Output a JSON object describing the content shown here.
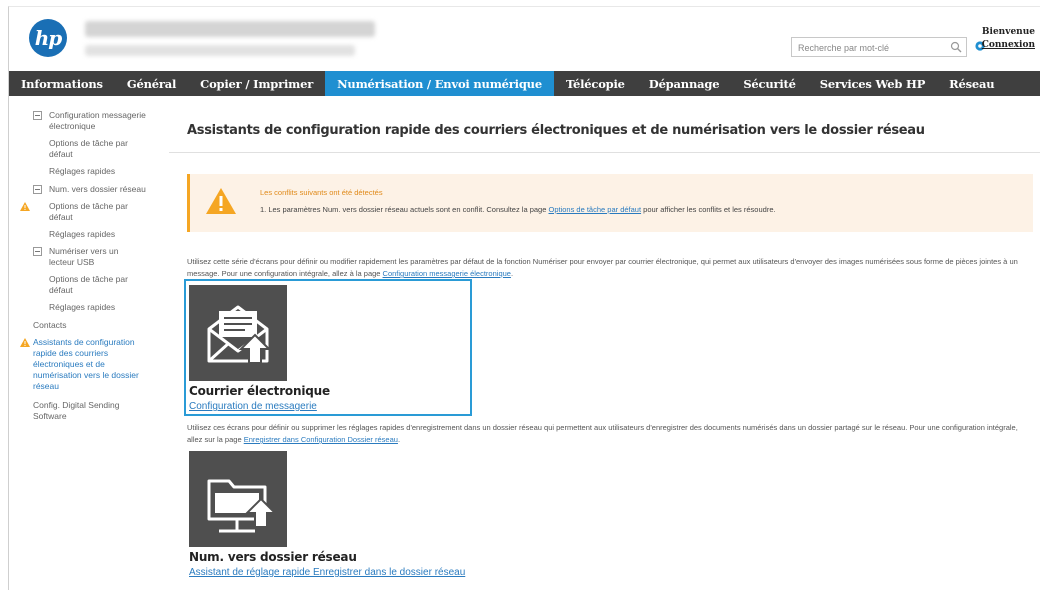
{
  "header": {
    "logo_text": "hp",
    "search_placeholder": "Recherche par mot-clé",
    "welcome": "Bienvenue",
    "login": "Connexion"
  },
  "nav": {
    "tabs": [
      {
        "label": "Informations"
      },
      {
        "label": "Général"
      },
      {
        "label": "Copier / Imprimer"
      },
      {
        "label": "Numérisation / Envoi numérique"
      },
      {
        "label": "Télécopie"
      },
      {
        "label": "Dépannage"
      },
      {
        "label": "Sécurité"
      },
      {
        "label": "Services Web HP"
      },
      {
        "label": "Réseau"
      }
    ],
    "active_index": 3
  },
  "sidebar": {
    "items": [
      {
        "label": "Configuration messagerie électronique"
      },
      {
        "label": "Options de tâche par défaut"
      },
      {
        "label": "Réglages rapides"
      },
      {
        "label": "Num. vers dossier réseau"
      },
      {
        "label": "Options de tâche par défaut"
      },
      {
        "label": "Réglages rapides"
      },
      {
        "label": "Numériser vers un lecteur USB"
      },
      {
        "label": "Options de tâche par défaut"
      },
      {
        "label": "Réglages rapides"
      },
      {
        "label": "Contacts"
      },
      {
        "label": "Assistants de configuration rapide des courriers électroniques et de numérisation vers le dossier réseau"
      },
      {
        "label": "Config. Digital Sending Software"
      }
    ]
  },
  "main": {
    "title": "Assistants de configuration rapide des courriers électroniques et de numérisation vers le dossier réseau",
    "alert": {
      "title": "Les conflits suivants ont été détectés",
      "message_prefix": "1.  Les paramètres Num. vers dossier réseau actuels sont en conflit. Consultez la page ",
      "message_link": "Options de tâche par défaut",
      "message_suffix": " pour afficher les conflits et les résoudre."
    },
    "email_desc_text": "Utilisez cette série d'écrans pour définir ou modifier rapidement les paramètres par défaut de la fonction Numériser pour envoyer par courrier électronique, qui permet aux utilisateurs d'envoyer des images numérisées sous forme de pièces jointes à un message. Pour une configuration intégrale, allez à la page ",
    "email_desc_link": "Configuration messagerie électronique",
    "email_desc_end": ".",
    "email_card": {
      "title": "Courrier électronique",
      "link": "Configuration de messagerie"
    },
    "folder_desc_text": "Utilisez ces écrans pour définir ou supprimer les réglages rapides d'enregistrement dans un dossier réseau qui permettent aux utilisateurs d'enregistrer des documents numérisés dans un dossier partagé sur le réseau. Pour une configuration intégrale, allez sur la page ",
    "folder_desc_link": "Enregistrer dans Configuration Dossier réseau",
    "folder_desc_end": ".",
    "folder_card": {
      "title": "Num. vers dossier réseau",
      "link": "Assistant de réglage rapide Enregistrer dans le dossier réseau"
    }
  },
  "colors": {
    "nav_bg": "#3f3f3f",
    "nav_active": "#1f8fd1",
    "link": "#2a7bbf",
    "warning": "#f5a623",
    "highlight_border": "#2a9bd6",
    "tile_bg": "#4f4f4f"
  }
}
